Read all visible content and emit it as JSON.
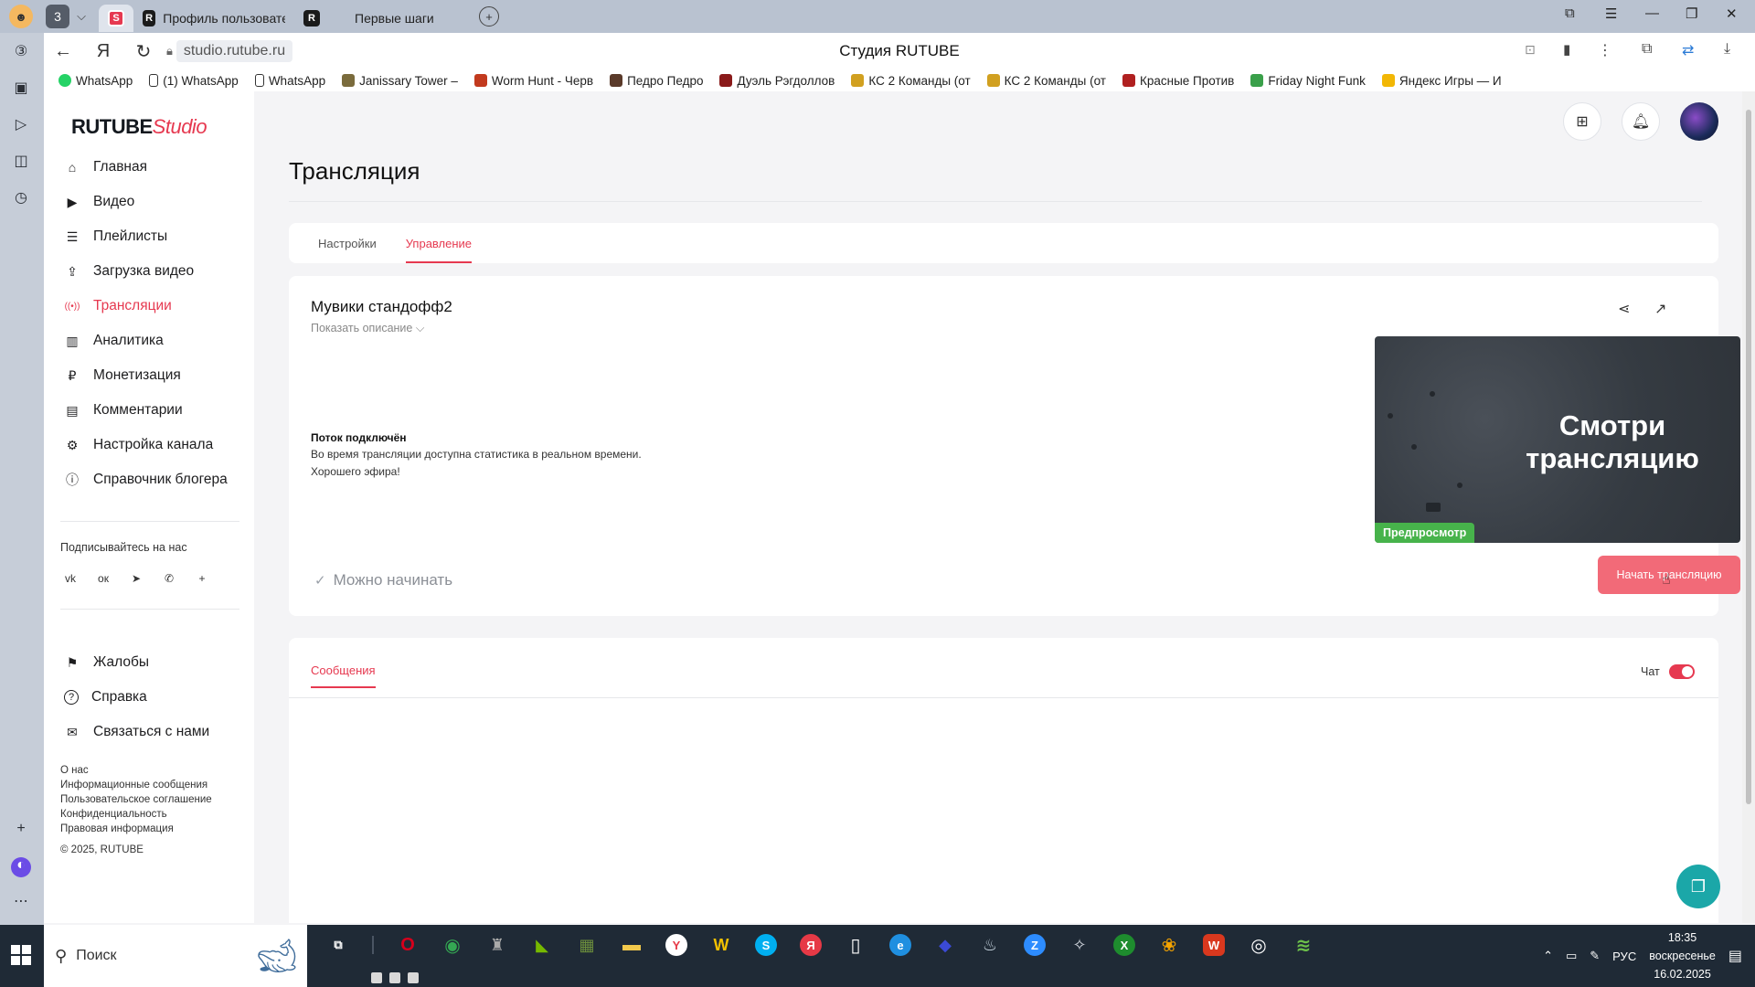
{
  "browser": {
    "tab_count": "3",
    "tabs": [
      {
        "label": "Профиль пользователя M"
      },
      {
        "label": "Первые шаги"
      }
    ],
    "url": "studio.rutube.ru",
    "page_heading": "Студия RUTUBE",
    "bookmarks": [
      {
        "label": "WhatsApp",
        "color": "#25d366"
      },
      {
        "label": "(1) WhatsApp",
        "color": "#ffffff"
      },
      {
        "label": "WhatsApp",
        "color": "#ffffff"
      },
      {
        "label": "Janissary Tower –",
        "color": "#7a6b3c"
      },
      {
        "label": "Worm Hunt - Черв",
        "color": "#c23a1e"
      },
      {
        "label": "Педро Педро",
        "color": "#5a3a2a"
      },
      {
        "label": "Дуэль Рэгдоллов",
        "color": "#8a1a1a"
      },
      {
        "label": "КС 2 Команды (от",
        "color": "#d1a020"
      },
      {
        "label": "КС 2 Команды (от",
        "color": "#d1a020"
      },
      {
        "label": "Красные Против",
        "color": "#b02020"
      },
      {
        "label": "Friday Night Funk",
        "color": "#3aa04a"
      },
      {
        "label": "Яндекс Игры — И",
        "color": "#f2b705"
      }
    ]
  },
  "sidebar": {
    "logo_main": "RUTUBE",
    "logo_studio": "Studio",
    "menu": [
      {
        "label": "Главная",
        "icon": "home-icon",
        "glyph": "⌂"
      },
      {
        "label": "Видео",
        "icon": "video-icon",
        "glyph": "▶"
      },
      {
        "label": "Плейлисты",
        "icon": "playlist-icon",
        "glyph": "☰"
      },
      {
        "label": "Загрузка видео",
        "icon": "upload-icon",
        "glyph": "⇪"
      },
      {
        "label": "Трансляции",
        "icon": "broadcast-icon",
        "glyph": "((•))",
        "active": true
      },
      {
        "label": "Аналитика",
        "icon": "analytics-icon",
        "glyph": "▥"
      },
      {
        "label": "Монетизация",
        "icon": "monetization-icon",
        "glyph": "₽"
      },
      {
        "label": "Комментарии",
        "icon": "comments-icon",
        "glyph": "▤"
      },
      {
        "label": "Настройка канала",
        "icon": "settings-icon",
        "glyph": "⚙"
      },
      {
        "label": "Справочник блогера",
        "icon": "info-icon",
        "glyph": "ⓘ"
      }
    ],
    "subscribe_title": "Подписывайтесь на нас",
    "socials": [
      {
        "icon": "vk-icon",
        "glyph": "vk"
      },
      {
        "icon": "ok-icon",
        "glyph": "ок"
      },
      {
        "icon": "telegram-icon",
        "glyph": "➤"
      },
      {
        "icon": "viber-icon",
        "glyph": "✆"
      },
      {
        "icon": "more-icon",
        "glyph": "+"
      }
    ],
    "bottom_menu": [
      {
        "label": "Жалобы",
        "icon": "flag-icon",
        "glyph": "⚑"
      },
      {
        "label": "Справка",
        "icon": "help-icon",
        "glyph": "?"
      },
      {
        "label": "Связаться с нами",
        "icon": "mail-icon",
        "glyph": "✉"
      }
    ],
    "footer_links": [
      "О нас",
      "Информационные сообщения",
      "Пользовательское соглашение",
      "Конфиденциальность",
      "Правовая информация"
    ],
    "copyright": "© 2025, RUTUBE"
  },
  "page": {
    "title": "Трансляция",
    "tabs": [
      {
        "label": "Настройки",
        "active": false
      },
      {
        "label": "Управление",
        "active": true
      }
    ],
    "stream": {
      "name": "Мувики стандофф2",
      "show_description": "Показать описание ⌵",
      "preview_text": "Смотри трансляцию",
      "preview_badge": "Предпросмотр",
      "status_title": "Поток подключён",
      "status_line1": "Во время трансляции доступна статистика в реальном времени.",
      "status_line2": "Хорошего эфира!",
      "ready_label": "Можно начинать",
      "start_button": "Начать трансляцию"
    },
    "chat": {
      "messages_tab": "Сообщения",
      "chat_label": "Чат",
      "chat_enabled": true
    }
  },
  "taskbar": {
    "search_placeholder": "Поиск",
    "lang": "РУС",
    "time": "18:35",
    "weekday": "воскресенье",
    "date": "16.02.2025",
    "apps": [
      {
        "icon": "opera-icon",
        "color": "#d6001c",
        "glyph": "O"
      },
      {
        "icon": "chrome-icon",
        "color": "#34a853",
        "glyph": "◉"
      },
      {
        "icon": "game-icon",
        "color": "#3a3a3a",
        "glyph": "♜"
      },
      {
        "icon": "nvidia-icon",
        "color": "#76b900",
        "glyph": "◣"
      },
      {
        "icon": "minecraft-icon",
        "color": "#6c8f3c",
        "glyph": "▦"
      },
      {
        "icon": "explorer-icon",
        "color": "#f2c94c",
        "glyph": "▬"
      },
      {
        "icon": "yandex-browser-icon",
        "color": "#ffffff",
        "glyph": "Y"
      },
      {
        "icon": "pacman-icon",
        "color": "#f2c100",
        "glyph": "W"
      },
      {
        "icon": "skype-icon",
        "color": "#00aff0",
        "glyph": "S"
      },
      {
        "icon": "yandex-icon",
        "color": "#e63946",
        "glyph": "Я"
      },
      {
        "icon": "file-icon",
        "color": "#ffffff",
        "glyph": "▯"
      },
      {
        "icon": "edge-icon",
        "color": "#1f8fe0",
        "glyph": "e"
      },
      {
        "icon": "app-icon",
        "color": "#1e2a8a",
        "glyph": "◆"
      },
      {
        "icon": "steam-icon",
        "color": "#1b2838",
        "glyph": "♨"
      },
      {
        "icon": "zoom-icon",
        "color": "#2d8cff",
        "glyph": "Z"
      },
      {
        "icon": "valorant-icon",
        "color": "#cfd4dc",
        "glyph": "✧"
      },
      {
        "icon": "xbox-icon",
        "color": "#1e8c2e",
        "glyph": "X"
      },
      {
        "icon": "photos-icon",
        "color": "#f4a300",
        "glyph": "❀"
      },
      {
        "icon": "wps-icon",
        "color": "#d9381e",
        "glyph": "W"
      },
      {
        "icon": "obs-icon",
        "color": "#cc1f1f",
        "glyph": "◎"
      },
      {
        "icon": "bluestacks-icon",
        "color": "#6cc04a",
        "glyph": "≋"
      }
    ]
  }
}
